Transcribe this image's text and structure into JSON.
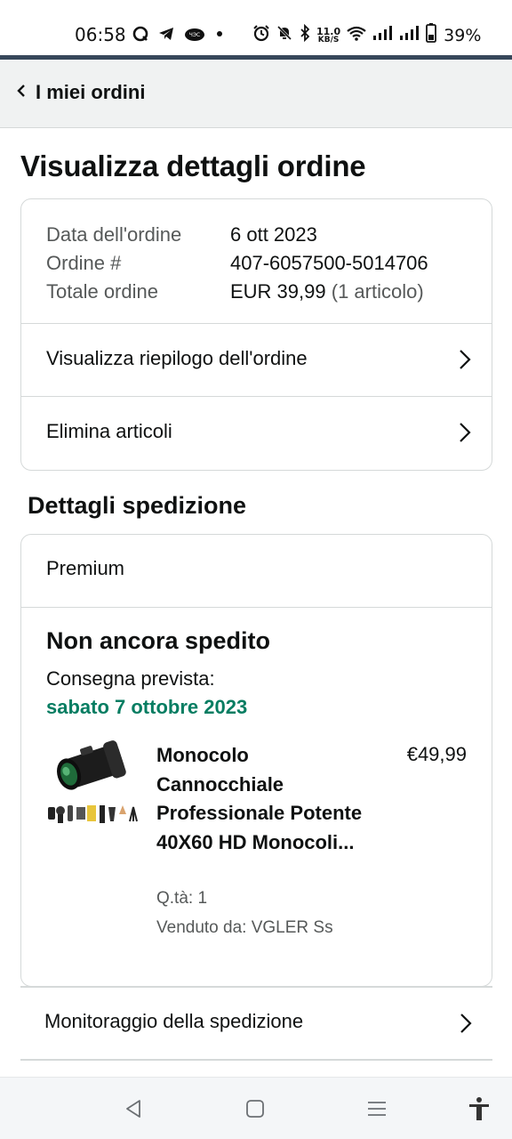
{
  "status_bar": {
    "time": "06:58",
    "net_speed_value": "11.0",
    "net_speed_unit": "KB/S",
    "battery_percent": "39%"
  },
  "header": {
    "back_label": "I miei ordini"
  },
  "page": {
    "title": "Visualizza dettagli ordine"
  },
  "order_summary": {
    "rows": [
      {
        "label": "Data dell'ordine",
        "value": "6 ott 2023",
        "extra": ""
      },
      {
        "label": "Ordine #",
        "value": "407-6057500-5014706",
        "extra": ""
      },
      {
        "label": "Totale ordine",
        "value": "EUR 39,99",
        "extra": "(1 articolo)"
      }
    ],
    "links": [
      {
        "label": "Visualizza riepilogo dell'ordine"
      },
      {
        "label": "Elimina articoli"
      }
    ]
  },
  "shipping": {
    "heading": "Dettagli spedizione",
    "service": "Premium",
    "status": "Non ancora spedito",
    "delivery_label": "Consegna prevista:",
    "delivery_date": "sabato 7 ottobre 2023",
    "item": {
      "title": "Monocolo Cannocchiale Professionale Potente 40X60 HD Monocoli...",
      "price": "€49,99",
      "quantity": "Q.tà: 1",
      "seller": "Venduto da: VGLER Ss"
    },
    "tracking_label": "Monitoraggio della spedizione"
  },
  "colors": {
    "delivery_green": "#067d62",
    "header_bg": "#f0f2f2",
    "divider_band": "#37475a"
  },
  "icons": {
    "status_left": [
      "q-app-icon",
      "telegram-icon",
      "cloud-app-icon",
      "dot-icon"
    ],
    "status_right": [
      "alarm-icon",
      "bell-off-icon",
      "bluetooth-icon",
      "wifi-icon",
      "signal-icon",
      "signal-icon",
      "battery-icon"
    ],
    "android_nav": [
      "back-triangle-icon",
      "home-square-icon",
      "recents-menu-icon",
      "accessibility-icon"
    ]
  }
}
